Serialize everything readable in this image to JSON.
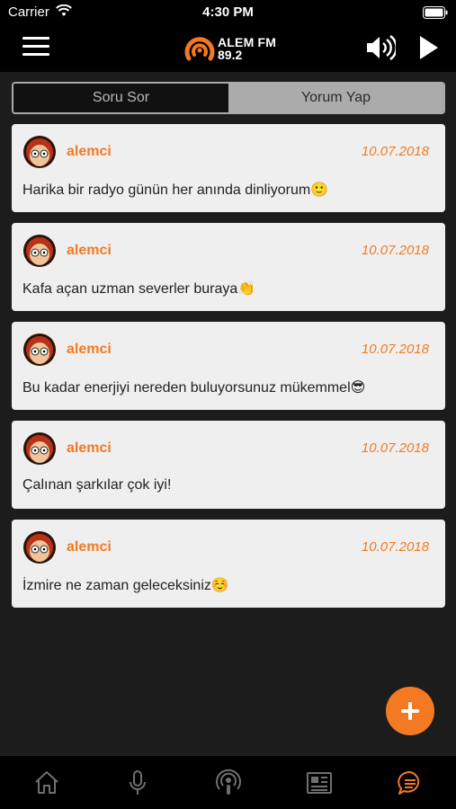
{
  "status_bar": {
    "carrier": "Carrier",
    "time": "4:30 PM"
  },
  "header": {
    "logo_line1": "ALEM FM",
    "logo_line2": "89.2",
    "menu_icon": "hamburger-menu-icon",
    "volume_icon": "speaker-volume-icon",
    "play_icon": "play-icon"
  },
  "tabs_segment": {
    "left_label": "Soru Sor",
    "right_label": "Yorum Yap",
    "selected": "Yorum Yap"
  },
  "comments": [
    {
      "user": "alemci",
      "date": "10.07.2018",
      "text": "Harika bir radyo günün her anında dinliyorum🙂"
    },
    {
      "user": "alemci",
      "date": "10.07.2018",
      "text": "Kafa açan uzman severler buraya👏"
    },
    {
      "user": "alemci",
      "date": "10.07.2018",
      "text": "Bu kadar enerjiyi nereden buluyorsunuz mükemmel😎"
    },
    {
      "user": "alemci",
      "date": "10.07.2018",
      "text": "Çalınan şarkılar çok iyi!"
    },
    {
      "user": "alemci",
      "date": "10.07.2018",
      "text": "İzmire ne zaman geleceksiniz☺️"
    }
  ],
  "fab": {
    "icon": "plus-icon"
  },
  "bottom_tabs": [
    {
      "icon": "home-icon",
      "active": false
    },
    {
      "icon": "microphone-icon",
      "active": false
    },
    {
      "icon": "podcast-icon",
      "active": false
    },
    {
      "icon": "newspaper-icon",
      "active": false
    },
    {
      "icon": "chat-bubble-icon",
      "active": true
    }
  ],
  "colors": {
    "accent": "#f37a22",
    "background": "#1c1c1c",
    "card": "#efefef",
    "bar": "#000000"
  }
}
